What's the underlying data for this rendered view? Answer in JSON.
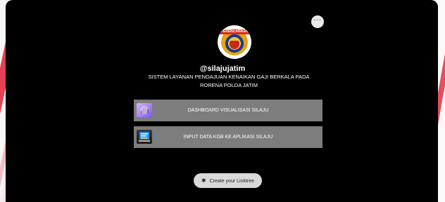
{
  "profile": {
    "handle": "@silajujatim",
    "description_line1": "SISTEM LAYANAN PENGAJUAN KENAIKAN GAJI BERKALA PADA",
    "description_line2": "RORENA POLDA JATIM",
    "logo_banner_text": "PERENCANAAN"
  },
  "header": {
    "more_label": "···"
  },
  "links": [
    {
      "label": "DASHBOARD VISUALISASI SILAJU",
      "icon": "dashboard-analytics-icon"
    },
    {
      "label": "INPUT DATA KGB KE APLIKASI SILAJU",
      "icon": "data-entry-icon"
    }
  ],
  "footer": {
    "cta_label": "Create your Linktree",
    "cta_icon": "linktree-sparkle-icon"
  },
  "colors": {
    "panel": "#000000",
    "link_bg": "#7d7d7d",
    "accent_red": "#e3203a"
  }
}
